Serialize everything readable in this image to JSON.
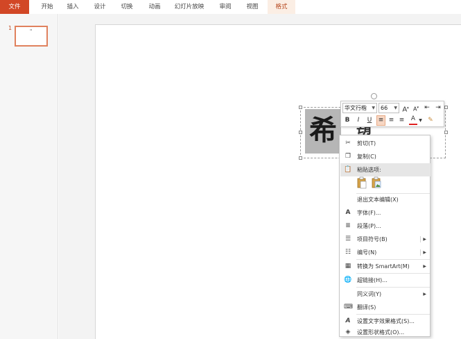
{
  "ribbon": {
    "tabs": [
      "文件",
      "开始",
      "插入",
      "设计",
      "切换",
      "动画",
      "幻灯片放映",
      "审阅",
      "视图",
      "格式"
    ],
    "active_tab": "格式"
  },
  "thumbnails": {
    "slide_number": "1",
    "mark": "\""
  },
  "slide": {
    "text_glyph": "希",
    "partial_glyph": "望"
  },
  "mini_toolbar": {
    "font_name": "华文行楷",
    "font_size": "66",
    "increase_font": "A",
    "decrease_font": "A",
    "bold": "B",
    "italic": "I",
    "underline": "U",
    "font_color": "A"
  },
  "context_menu": {
    "items": [
      {
        "label": "剪切(T)",
        "icon": "scissors-icon"
      },
      {
        "label": "复制(C)",
        "icon": "copy-icon"
      },
      {
        "label": "粘贴选项:",
        "icon": "paste-icon"
      },
      {
        "label": "退出文本编辑(X)",
        "icon": ""
      },
      {
        "label": "字体(F)...",
        "icon": "font-icon"
      },
      {
        "label": "段落(P)...",
        "icon": "paragraph-icon"
      },
      {
        "label": "项目符号(B)",
        "icon": "bullets-icon"
      },
      {
        "label": "编号(N)",
        "icon": "numbering-icon"
      },
      {
        "label": "转换为 SmartArt(M)",
        "icon": "smartart-icon"
      },
      {
        "label": "超链接(H)...",
        "icon": "hyperlink-icon"
      },
      {
        "label": "同义词(Y)",
        "icon": ""
      },
      {
        "label": "翻译(S)",
        "icon": "translate-icon"
      },
      {
        "label": "设置文字效果格式(S)...",
        "icon": "text-effect-icon"
      },
      {
        "label": "设置形状格式(O)...",
        "icon": "shape-format-icon"
      }
    ]
  },
  "colors": {
    "accent": "#d24726",
    "active_tab_bg": "#fbeee4",
    "font_color_bar": "#e02020"
  }
}
